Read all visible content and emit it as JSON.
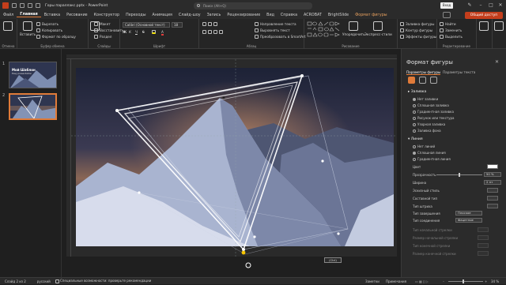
{
  "window": {
    "filename": "Горы параллакс.pptx",
    "app_name": "PowerPoint",
    "search_placeholder": "Поиск (Alt+Q)",
    "signin_label": "Вход"
  },
  "tabs": [
    "Файл",
    "Главная",
    "Вставка",
    "Рисование",
    "Конструктор",
    "Переходы",
    "Анимация",
    "Слайд-шоу",
    "Запись",
    "Рецензирование",
    "Вид",
    "Справка",
    "ACROBAT",
    "BrightSlide",
    "Формат фигуры"
  ],
  "active_tab": "Главная",
  "share_button": "Общий доступ",
  "ribbon": {
    "undo": {
      "label": "Отмена"
    },
    "clipboard": {
      "paste": "Вставить",
      "cut": "Вырезать",
      "copy": "Копировать",
      "format_painter": "Формат по образцу",
      "label": "Буфер обмена"
    },
    "slides": {
      "new_slide": "Создать слайд",
      "layout": "Макет",
      "reset": "Восстановить",
      "section": "Раздел",
      "label": "Слайды"
    },
    "font": {
      "name": "Calibri (Основной текст)",
      "size": "18",
      "label": "Шрифт"
    },
    "paragraph": {
      "text_direction": "Направление текста",
      "align_text": "Выровнять текст",
      "smartart": "Преобразовать в SmartArt",
      "label": "Абзац"
    },
    "drawing": {
      "arrange": "Упорядочить",
      "quick_styles": "Экспресс-стили",
      "label": "Рисование"
    },
    "shape_format": {
      "fill": "Заливка фигуры",
      "outline": "Контур фигуры",
      "effects": "Эффекты фигуры"
    },
    "editing": {
      "find": "Найти",
      "replace": "Заменить",
      "select": "Выделить",
      "label": "Редактирование"
    },
    "voice": {
      "dictate": "Диктовать",
      "label": "Голос"
    },
    "designer": {
      "label": "Конструктор"
    }
  },
  "thumbnails": [
    {
      "number": "1",
      "title": "Мой Шаблон",
      "subtitle": "Easy presentation"
    },
    {
      "number": "2"
    }
  ],
  "format_pane": {
    "title": "Формат фигуры",
    "tabs": [
      "Параметры фигуры",
      "Параметры текста"
    ],
    "fill": {
      "header": "Заливка",
      "options": [
        "Нет заливки",
        "Сплошная заливка",
        "Градиентная заливка",
        "Рисунок или текстура",
        "Узорная заливка",
        "Заливка фона"
      ]
    },
    "line": {
      "header": "Линия",
      "options": [
        "Нет линий",
        "Сплошная линия",
        "Градиентная линия"
      ],
      "color_label": "Цвет",
      "transparency_label": "Прозрачность",
      "transparency_value": "50 %",
      "width_label": "Ширина",
      "width_value": "2 пт",
      "sketched_label": "Эскизный стиль",
      "compound_label": "Составной тип",
      "dash_label": "Тип штриха",
      "cap_label": "Тип завершения",
      "cap_value": "Плоское",
      "join_label": "Тип соединения",
      "join_value": "Фацетное",
      "begin_arrow_type": "Тип начальной стрелки",
      "begin_arrow_size": "Размер начальной стрелки",
      "end_arrow_type": "Тип конечной стрелки",
      "end_arrow_size": "Размер конечной стрелки"
    }
  },
  "ctrl_tag": "(Ctrl)",
  "status": {
    "slide": "Слайд 2 из 2",
    "language": "русский",
    "accessibility": "Специальные возможности: проверьте рекомендации",
    "notes": "Заметки",
    "comments": "Примечания",
    "zoom": "34 %"
  },
  "colors": {
    "accent": "#e07b39",
    "share": "#c43e1c",
    "background": "#1f1f1f"
  }
}
